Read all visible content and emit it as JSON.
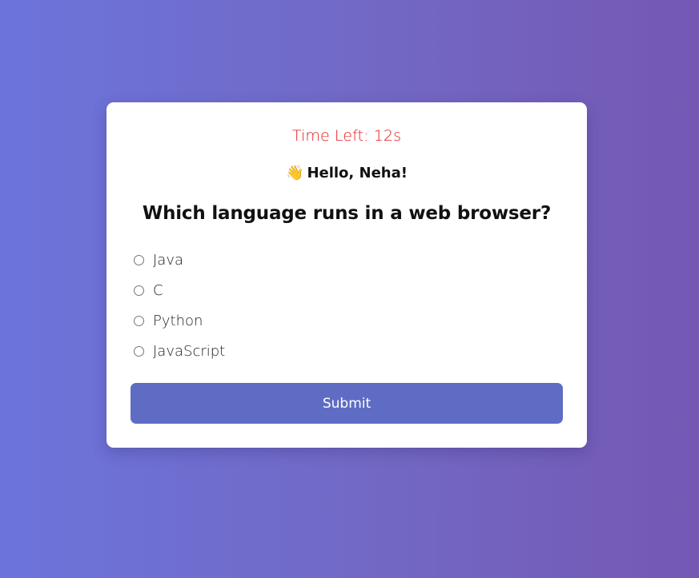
{
  "quiz": {
    "timer_text": "Time Left: 12s",
    "greeting_icon": "👋",
    "greeting_text": "Hello, Neha!",
    "question": "Which language runs in a web browser?",
    "options": [
      {
        "label": "Java",
        "selected": false
      },
      {
        "label": "C",
        "selected": false
      },
      {
        "label": "Python",
        "selected": false
      },
      {
        "label": "JavaScript",
        "selected": false
      }
    ],
    "submit_label": "Submit"
  },
  "colors": {
    "timer": "#e01b1b",
    "submit_button": "#5f6cc4",
    "background_start": "#6c74db",
    "background_end": "#7458b4"
  }
}
